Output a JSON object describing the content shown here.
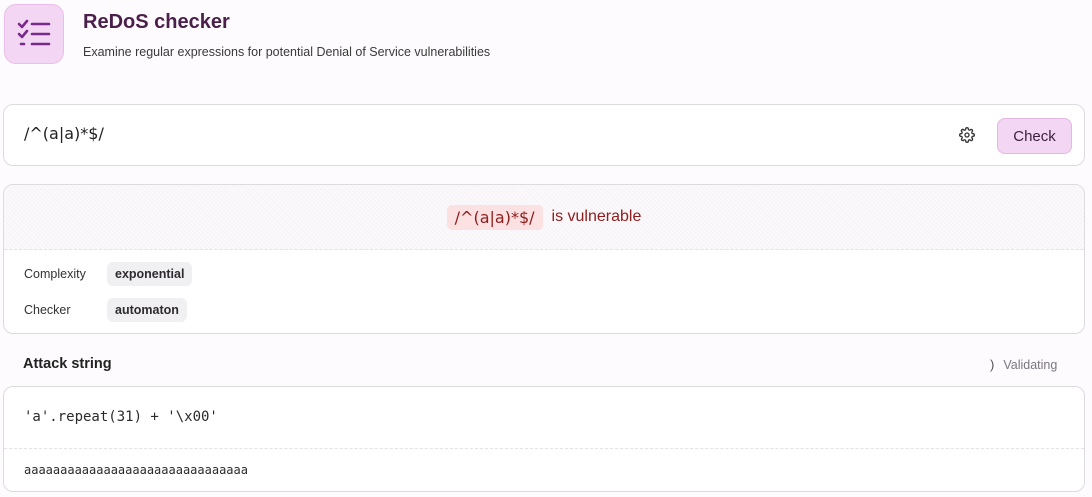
{
  "app": {
    "title": "ReDoS checker",
    "subtitle": "Examine regular expressions for potential Denial of Service vulnerabilities",
    "logo_icon": "checklist-icon"
  },
  "input": {
    "value": "/^(a|a)*$/",
    "settings_icon": "gear-icon",
    "check_label": "Check"
  },
  "result": {
    "regex": "/^(a|a)*$/",
    "status_text": "is vulnerable",
    "rows": [
      {
        "label": "Complexity",
        "value": "exponential"
      },
      {
        "label": "Checker",
        "value": "automaton"
      }
    ]
  },
  "attack": {
    "title": "Attack string",
    "status_text": "Validating",
    "code": "'a'.repeat(31) + '\\x00'",
    "sample": "aaaaaaaaaaaaaaaaaaaaaaaaaaaaaaa"
  },
  "colors": {
    "accent": "#f3d6f3",
    "brand_icon": "#7a2a8a",
    "danger_text": "#8f1c1c",
    "danger_bg": "#fbe1e1"
  }
}
